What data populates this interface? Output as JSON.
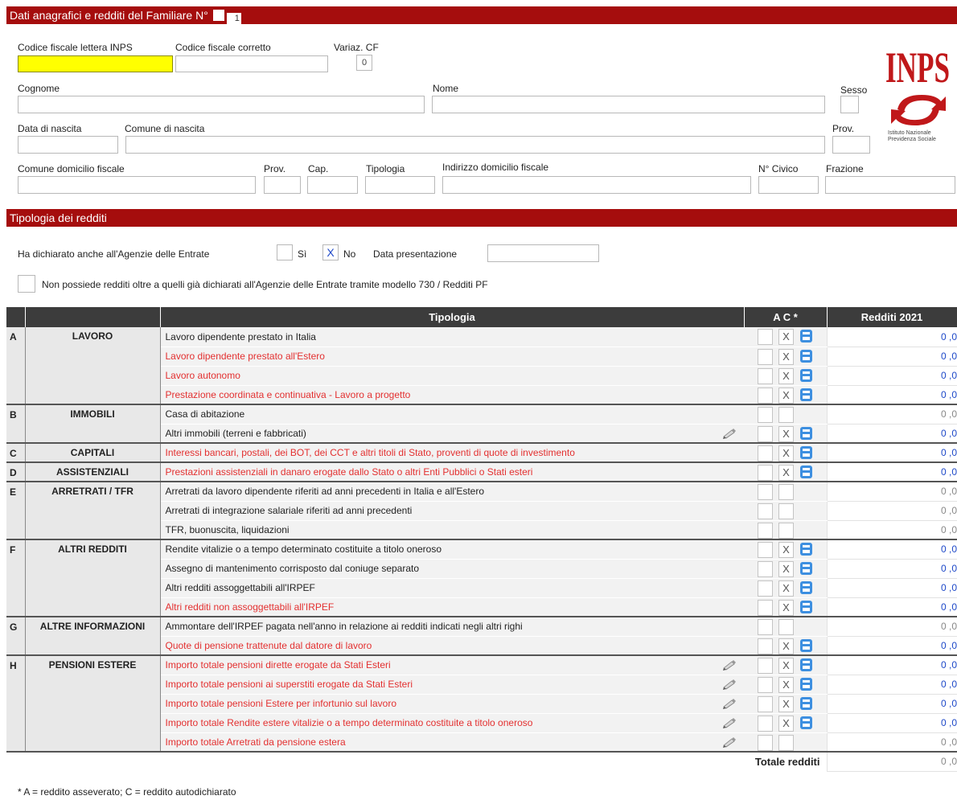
{
  "header1": {
    "title": "Dati anagrafici e redditi del Familiare N°",
    "number": "1"
  },
  "fields": {
    "codice_fiscale_inps_label": "Codice fiscale lettera INPS",
    "codice_fiscale_corretto_label": "Codice fiscale corretto",
    "variaz_cf_label": "Variaz. CF",
    "variaz_cf_value": "0",
    "cognome_label": "Cognome",
    "nome_label": "Nome",
    "sesso_label": "Sesso",
    "data_nascita_label": "Data di nascita",
    "comune_nascita_label": "Comune di nascita",
    "prov_label": "Prov.",
    "comune_domicilio_label": "Comune domicilio fiscale",
    "prov2_label": "Prov.",
    "cap_label": "Cap.",
    "tipologia_label": "Tipologia",
    "indirizzo_label": "Indirizzo domicilio fiscale",
    "civico_label": "N° Civico",
    "frazione_label": "Frazione"
  },
  "logo": {
    "text": "INPS",
    "subtitle_line1": "Istituto Nazionale",
    "subtitle_line2": "Previdenza Sociale"
  },
  "header2": {
    "title": "Tipologia dei redditi"
  },
  "dichiarazione": {
    "label": "Ha dichiarato anche all'Agenzie delle Entrate",
    "si_label": "Sì",
    "no_label": "No",
    "no_checked": "X",
    "data_label": "Data presentazione",
    "non_possiede_label": "Non possiede redditi oltre a quelli già dichiarati all'Agenzie delle Entrate tramite modello 730 / Redditi PF"
  },
  "table": {
    "col_tipologia": "Tipologia",
    "col_ac": "A  C *",
    "col_redditi": "Redditi 2021",
    "rows": [
      {
        "letter": "A",
        "category": "LAVORO",
        "desc": "Lavoro dipendente prestato in Italia",
        "red": false,
        "x": true,
        "calc": true,
        "pencil": false,
        "value": "0 ,0",
        "grey": false
      },
      {
        "letter": "",
        "category": "",
        "desc": "Lavoro dipendente prestato all'Estero",
        "red": true,
        "x": true,
        "calc": true,
        "pencil": false,
        "value": "0 ,0",
        "grey": false
      },
      {
        "letter": "",
        "category": "",
        "desc": "Lavoro autonomo",
        "red": true,
        "x": true,
        "calc": true,
        "pencil": false,
        "value": "0 ,0",
        "grey": false
      },
      {
        "letter": "",
        "category": "",
        "desc": "Prestazione coordinata e continuativa - Lavoro a progetto",
        "red": true,
        "x": true,
        "calc": true,
        "pencil": false,
        "value": "0 ,0",
        "grey": false
      },
      {
        "letter": "B",
        "category": "IMMOBILI",
        "desc": "Casa di abitazione",
        "red": false,
        "x": false,
        "calc": false,
        "pencil": false,
        "value": "0 ,0",
        "grey": true
      },
      {
        "letter": "",
        "category": "",
        "desc": "Altri immobili (terreni e fabbricati)",
        "red": false,
        "x": true,
        "calc": true,
        "pencil": true,
        "value": "0 ,0",
        "grey": false
      },
      {
        "letter": "C",
        "category": "CAPITALI",
        "desc": "Interessi bancari, postali, dei BOT, dei CCT e altri titoli di Stato, proventi di quote di investimento",
        "red": true,
        "x": true,
        "calc": true,
        "pencil": false,
        "value": "0 ,0",
        "grey": false
      },
      {
        "letter": "D",
        "category": "ASSISTENZIALI",
        "desc": "Prestazioni assistenziali in danaro erogate dallo Stato o altri Enti Pubblici o Stati esteri",
        "red": true,
        "x": true,
        "calc": true,
        "pencil": false,
        "value": "0 ,0",
        "grey": false
      },
      {
        "letter": "E",
        "category": "ARRETRATI / TFR",
        "desc": "Arretrati da lavoro dipendente riferiti ad anni precedenti in Italia e all'Estero",
        "red": false,
        "x": false,
        "calc": false,
        "pencil": false,
        "value": "0 ,0",
        "grey": true
      },
      {
        "letter": "",
        "category": "",
        "desc": "Arretrati di integrazione salariale riferiti ad anni precedenti",
        "red": false,
        "x": false,
        "calc": false,
        "pencil": false,
        "value": "0 ,0",
        "grey": true
      },
      {
        "letter": "",
        "category": "",
        "desc": "TFR, buonuscita, liquidazioni",
        "red": false,
        "x": false,
        "calc": false,
        "pencil": false,
        "value": "0 ,0",
        "grey": true
      },
      {
        "letter": "F",
        "category": "ALTRI REDDITI",
        "desc": "Rendite vitalizie o a tempo determinato costituite a titolo oneroso",
        "red": false,
        "x": true,
        "calc": true,
        "pencil": false,
        "value": "0 ,0",
        "grey": false
      },
      {
        "letter": "",
        "category": "",
        "desc": "Assegno di mantenimento corrisposto dal coniuge separato",
        "red": false,
        "x": true,
        "calc": true,
        "pencil": false,
        "value": "0 ,0",
        "grey": false
      },
      {
        "letter": "",
        "category": "",
        "desc": "Altri redditi assoggettabili all'IRPEF",
        "red": false,
        "x": true,
        "calc": true,
        "pencil": false,
        "value": "0 ,0",
        "grey": false
      },
      {
        "letter": "",
        "category": "",
        "desc": "Altri redditi non assoggettabili all'IRPEF",
        "red": true,
        "x": true,
        "calc": true,
        "pencil": false,
        "value": "0 ,0",
        "grey": false
      },
      {
        "letter": "G",
        "category": "ALTRE INFORMAZIONI",
        "desc": "Ammontare dell'IRPEF pagata nell'anno in relazione ai redditi indicati negli altri righi",
        "red": false,
        "x": false,
        "calc": false,
        "pencil": false,
        "value": "0 ,0",
        "grey": true
      },
      {
        "letter": "",
        "category": "",
        "desc": "Quote di pensione trattenute dal datore di lavoro",
        "red": true,
        "x": true,
        "calc": true,
        "pencil": false,
        "value": "0 ,0",
        "grey": false
      },
      {
        "letter": "H",
        "category": "PENSIONI ESTERE",
        "desc": "Importo totale pensioni dirette erogate da Stati Esteri",
        "red": true,
        "x": true,
        "calc": true,
        "pencil": true,
        "value": "0 ,0",
        "grey": false
      },
      {
        "letter": "",
        "category": "",
        "desc": "Importo totale pensioni ai superstiti erogate da Stati Esteri",
        "red": true,
        "x": true,
        "calc": true,
        "pencil": true,
        "value": "0 ,0",
        "grey": false
      },
      {
        "letter": "",
        "category": "",
        "desc": "Importo totale pensioni Estere per infortunio sul lavoro",
        "red": true,
        "x": true,
        "calc": true,
        "pencil": true,
        "value": "0 ,0",
        "grey": false
      },
      {
        "letter": "",
        "category": "",
        "desc": "Importo totale Rendite estere vitalizie o a tempo determinato costituite a titolo oneroso",
        "red": true,
        "x": true,
        "calc": true,
        "pencil": true,
        "value": "0 ,0",
        "grey": false
      },
      {
        "letter": "",
        "category": "",
        "desc": "Importo totale Arretrati da pensione estera",
        "red": true,
        "x": false,
        "calc": false,
        "pencil": true,
        "value": "0 ,0",
        "grey": true
      }
    ],
    "totale_label": "Totale redditi",
    "totale_value": "0 ,0"
  },
  "footnote": "* A = reddito asseverato; C = reddito autodichiarato",
  "colors": {
    "bar": "#a50d0d",
    "header_dark": "#3c3c3c",
    "red_text": "#e33030",
    "blue_value": "#1d48c8",
    "yellow_input": "#ffff00"
  }
}
